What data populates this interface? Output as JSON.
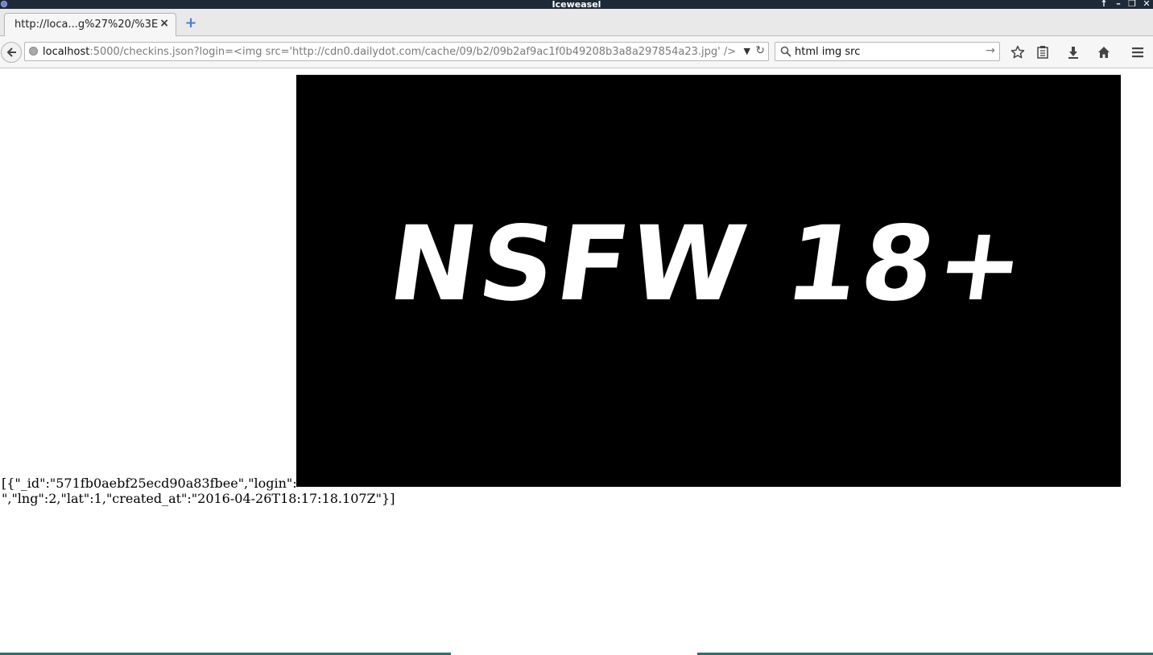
{
  "window": {
    "title": "Iceweasel",
    "app_icon": "iceweasel-icon",
    "controls": [
      "up-arrow-icon",
      "minimize-icon",
      "restore-icon",
      "close-icon"
    ]
  },
  "tabs": [
    {
      "label": "http://loca...g%27%20/%3E",
      "active": true,
      "close_icon": "close-icon"
    }
  ],
  "new_tab_icon": "plus-icon",
  "navbar": {
    "url_host": "localhost",
    "url_rest": ":5000/checkins.json?login=<img src='http://cdn0.dailydot.com/cache/09/b2/09b2af9ac1f0b49208b3a8a297854a23.jpg' />",
    "search_value": "html img src",
    "icons": [
      "back-icon",
      "globe-icon",
      "dropdown-icon",
      "reload-icon",
      "search-icon",
      "go-icon",
      "bookmark-star-icon",
      "reading-list-icon",
      "download-icon",
      "home-icon",
      "menu-icon"
    ]
  },
  "content": {
    "json_line1": "[{\"_id\":\"571fb0aebf25ecd90a83fbee\",\"login\":\"",
    "json_line2": "\",\"lng\":2,\"lat\":1,\"created_at\":\"2016-04-26T18:17:18.107Z\"}]",
    "image_text": "NSFW 18+"
  },
  "colors": {
    "titlebar": "#1f2a38",
    "tabstrip": "#e9e9e9",
    "navbar": "#f6f6f6",
    "image_bg": "#000000",
    "accent_blue": "#4a7ad1"
  }
}
